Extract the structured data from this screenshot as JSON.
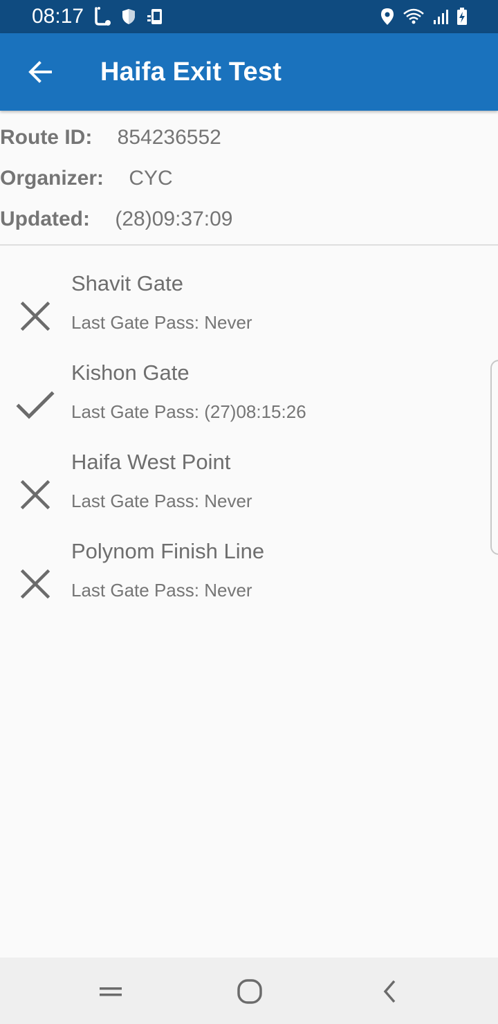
{
  "status_bar": {
    "time": "08:17",
    "left_icons": [
      "lyft-icon",
      "shield-icon",
      "phone-sync-icon"
    ],
    "right_icons": [
      "location-pin-icon",
      "wifi-icon",
      "signal-icon",
      "battery-charging-icon"
    ]
  },
  "app_bar": {
    "title": "Haifa Exit Test",
    "back_icon": "arrow-left-icon",
    "background": "#1a72bd"
  },
  "route_info": {
    "route_id_label": "Route ID:",
    "route_id_value": "854236552",
    "organizer_label": "Organizer:",
    "organizer_value": "CYC",
    "updated_label": "Updated:",
    "updated_value": "(28)09:37:09"
  },
  "gates": [
    {
      "name": "Shavit Gate",
      "last_pass": "Last Gate Pass: Never",
      "status": "not-passed",
      "icon": "close-icon"
    },
    {
      "name": "Kishon Gate",
      "last_pass": "Last Gate Pass: (27)08:15:26",
      "status": "passed",
      "icon": "check-icon"
    },
    {
      "name": "Haifa West Point",
      "last_pass": "Last Gate Pass: Never",
      "status": "not-passed",
      "icon": "close-icon"
    },
    {
      "name": "Polynom Finish Line",
      "last_pass": "Last Gate Pass: Never",
      "status": "not-passed",
      "icon": "close-icon"
    }
  ],
  "nav_bar": {
    "buttons": [
      "recents-icon",
      "home-icon",
      "back-icon"
    ]
  }
}
